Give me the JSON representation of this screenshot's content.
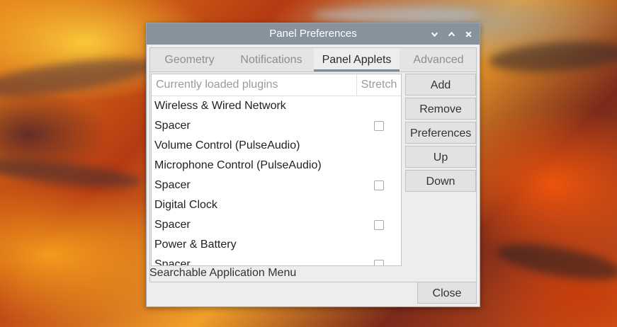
{
  "window": {
    "title": "Panel Preferences"
  },
  "tabs": [
    {
      "label": "Geometry",
      "active": false
    },
    {
      "label": "Notifications",
      "active": false
    },
    {
      "label": "Panel Applets",
      "active": true
    },
    {
      "label": "Advanced",
      "active": false
    }
  ],
  "plugins": {
    "header_name": "Currently loaded plugins",
    "header_stretch": "Stretch",
    "rows": [
      {
        "name": "Wireless & Wired Network",
        "has_stretch": false
      },
      {
        "name": "Spacer",
        "has_stretch": true
      },
      {
        "name": "Volume Control (PulseAudio)",
        "has_stretch": false
      },
      {
        "name": "Microphone Control (PulseAudio)",
        "has_stretch": false
      },
      {
        "name": "Spacer",
        "has_stretch": true
      },
      {
        "name": "Digital Clock",
        "has_stretch": false
      },
      {
        "name": "Spacer",
        "has_stretch": true
      },
      {
        "name": "Power & Battery",
        "has_stretch": false
      },
      {
        "name": "Spacer",
        "has_stretch": true
      }
    ]
  },
  "buttons": {
    "add": "Add",
    "remove": "Remove",
    "preferences": "Preferences",
    "up": "Up",
    "down": "Down",
    "close": "Close"
  },
  "status_text": "Searchable Application Menu",
  "colors": {
    "titlebar": "#87929c",
    "active_tab_underline": "#7f8a94"
  }
}
